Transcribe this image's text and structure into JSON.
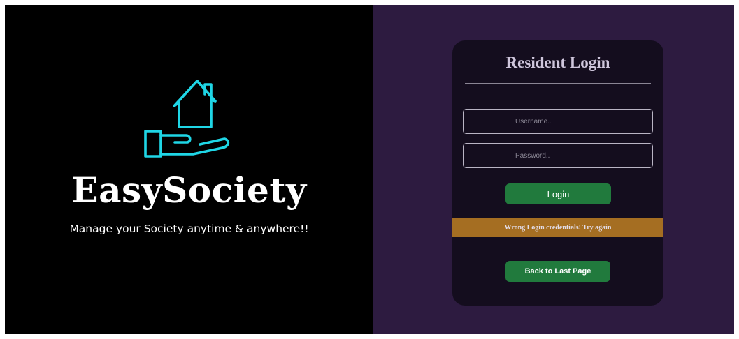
{
  "brand": {
    "name": "EasySociety",
    "tagline": "Manage your Society anytime & anywhere!!",
    "logo_icon": "house-in-hand-icon",
    "logo_color": "#1fd6e6"
  },
  "login": {
    "title": "Resident Login",
    "username_placeholder": "Username..",
    "password_placeholder": "Password..",
    "login_label": "Login",
    "error_message": "Wrong Login credentials! Try again",
    "back_label": "Back to Last Page"
  },
  "colors": {
    "left_background": "#000000",
    "right_background": "#2d1b40",
    "card_background": "#140d1e",
    "button_green": "#217a3d",
    "error_banner": "#a56e22"
  }
}
